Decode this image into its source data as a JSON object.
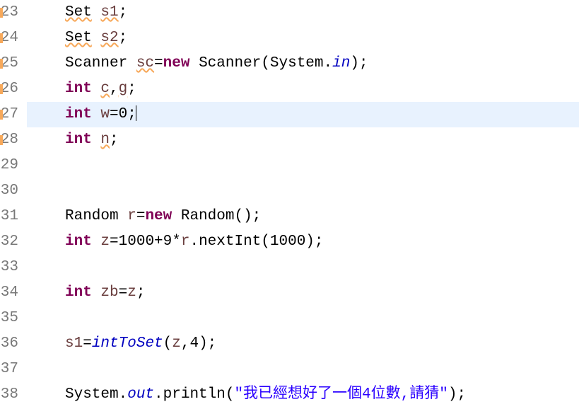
{
  "lines": [
    {
      "num": "23",
      "marker": true,
      "current": false,
      "tokens": [
        {
          "t": "Set",
          "cls": "type underline"
        },
        {
          "t": " ",
          "cls": ""
        },
        {
          "t": "s1",
          "cls": "ident underline"
        },
        {
          "t": ";",
          "cls": "punct"
        }
      ]
    },
    {
      "num": "24",
      "marker": true,
      "current": false,
      "tokens": [
        {
          "t": "Set",
          "cls": "type underline"
        },
        {
          "t": " ",
          "cls": ""
        },
        {
          "t": "s2",
          "cls": "ident underline"
        },
        {
          "t": ";",
          "cls": "punct"
        }
      ]
    },
    {
      "num": "25",
      "marker": true,
      "current": false,
      "tokens": [
        {
          "t": "Scanner ",
          "cls": "type"
        },
        {
          "t": "sc",
          "cls": "ident underline"
        },
        {
          "t": "=",
          "cls": "punct"
        },
        {
          "t": "new",
          "cls": "kw"
        },
        {
          "t": " Scanner(System.",
          "cls": "type"
        },
        {
          "t": "in",
          "cls": "field-static"
        },
        {
          "t": ");",
          "cls": "punct"
        }
      ]
    },
    {
      "num": "26",
      "marker": true,
      "current": false,
      "tokens": [
        {
          "t": "int",
          "cls": "kw"
        },
        {
          "t": " ",
          "cls": ""
        },
        {
          "t": "c",
          "cls": "ident underline"
        },
        {
          "t": ",",
          "cls": "punct"
        },
        {
          "t": "g",
          "cls": "ident underline"
        },
        {
          "t": ";",
          "cls": "punct"
        }
      ]
    },
    {
      "num": "27",
      "marker": true,
      "current": true,
      "cursor": true,
      "tokens": [
        {
          "t": "int",
          "cls": "kw"
        },
        {
          "t": " ",
          "cls": ""
        },
        {
          "t": "w",
          "cls": "ident"
        },
        {
          "t": "=0;",
          "cls": "punct"
        }
      ]
    },
    {
      "num": "28",
      "marker": true,
      "current": false,
      "tokens": [
        {
          "t": "int",
          "cls": "kw"
        },
        {
          "t": " ",
          "cls": ""
        },
        {
          "t": "n",
          "cls": "ident underline"
        },
        {
          "t": ";",
          "cls": "punct"
        }
      ]
    },
    {
      "num": "29",
      "marker": false,
      "current": false,
      "tokens": []
    },
    {
      "num": "30",
      "marker": false,
      "current": false,
      "tokens": []
    },
    {
      "num": "31",
      "marker": false,
      "current": false,
      "tokens": [
        {
          "t": "Random ",
          "cls": "type"
        },
        {
          "t": "r",
          "cls": "ident"
        },
        {
          "t": "=",
          "cls": "punct"
        },
        {
          "t": "new",
          "cls": "kw"
        },
        {
          "t": " Random();",
          "cls": "type"
        }
      ]
    },
    {
      "num": "32",
      "marker": false,
      "current": false,
      "tokens": [
        {
          "t": "int",
          "cls": "kw"
        },
        {
          "t": " ",
          "cls": ""
        },
        {
          "t": "z",
          "cls": "ident"
        },
        {
          "t": "=1000+9*",
          "cls": "punct"
        },
        {
          "t": "r",
          "cls": "ident"
        },
        {
          "t": ".nextInt(1000);",
          "cls": "method"
        }
      ]
    },
    {
      "num": "33",
      "marker": false,
      "current": false,
      "tokens": []
    },
    {
      "num": "34",
      "marker": false,
      "current": false,
      "tokens": [
        {
          "t": "int",
          "cls": "kw"
        },
        {
          "t": " ",
          "cls": ""
        },
        {
          "t": "zb",
          "cls": "ident"
        },
        {
          "t": "=",
          "cls": "punct"
        },
        {
          "t": "z",
          "cls": "ident"
        },
        {
          "t": ";",
          "cls": "punct"
        }
      ]
    },
    {
      "num": "35",
      "marker": false,
      "current": false,
      "tokens": []
    },
    {
      "num": "36",
      "marker": false,
      "current": false,
      "tokens": [
        {
          "t": "s1",
          "cls": "ident"
        },
        {
          "t": "=",
          "cls": "punct"
        },
        {
          "t": "intToSet",
          "cls": "field-static"
        },
        {
          "t": "(",
          "cls": "punct"
        },
        {
          "t": "z",
          "cls": "ident"
        },
        {
          "t": ",4);",
          "cls": "punct"
        }
      ]
    },
    {
      "num": "37",
      "marker": false,
      "current": false,
      "tokens": []
    },
    {
      "num": "38",
      "marker": false,
      "current": false,
      "tokens": [
        {
          "t": "System.",
          "cls": "type"
        },
        {
          "t": "out",
          "cls": "field-static"
        },
        {
          "t": ".println(",
          "cls": "method"
        },
        {
          "t": "\"我已經想好了一個4位數,請猜\"",
          "cls": "string"
        },
        {
          "t": ");",
          "cls": "punct"
        }
      ]
    }
  ]
}
